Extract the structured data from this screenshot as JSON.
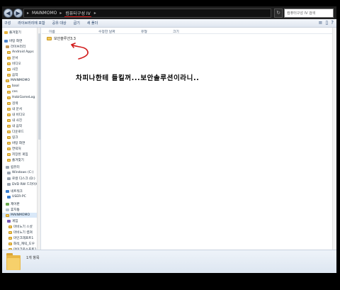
{
  "address_bar": {
    "breadcrumbs": [
      "MAINMOMO",
      "컴퓨터구성 IV"
    ],
    "search_placeholder": "컴퓨터구성 IV 검색"
  },
  "command_bar": {
    "items": [
      "구성",
      "라이브러리에 포함",
      "공유 대상",
      "굽기",
      "새 폴더"
    ],
    "view_icons": [
      "≡",
      "▯",
      "?"
    ]
  },
  "nav_pane": {
    "items": [
      {
        "label": "즐겨찾기",
        "icon": "star-icon"
      },
      {
        "label": "바탕 화면",
        "icon": "desktop-icon"
      },
      {
        "label": "라이브러리",
        "icon": "library-icon"
      },
      {
        "label": "Android Apps",
        "icon": "folder-icon"
      },
      {
        "label": "문서",
        "icon": "folder-icon"
      },
      {
        "label": "비디오",
        "icon": "folder-icon"
      },
      {
        "label": "사진",
        "icon": "folder-icon"
      },
      {
        "label": "음악",
        "icon": "folder-icon"
      },
      {
        "label": "MAINMOMO",
        "icon": "folder-icon"
      },
      {
        "label": "baal",
        "icon": "folder-icon"
      },
      {
        "label": "ces",
        "icon": "folder-icon"
      },
      {
        "label": "HobiGameLog",
        "icon": "folder-icon"
      },
      {
        "label": "검색",
        "icon": "folder-icon"
      },
      {
        "label": "내 문서",
        "icon": "folder-icon"
      },
      {
        "label": "내 비디오",
        "icon": "folder-icon"
      },
      {
        "label": "내 사진",
        "icon": "folder-icon"
      },
      {
        "label": "내 음악",
        "icon": "folder-icon"
      },
      {
        "label": "다운로드",
        "icon": "folder-icon"
      },
      {
        "label": "링크",
        "icon": "folder-icon"
      },
      {
        "label": "바탕 화면",
        "icon": "folder-icon"
      },
      {
        "label": "연락처",
        "icon": "folder-icon"
      },
      {
        "label": "저장된 게임",
        "icon": "folder-icon"
      },
      {
        "label": "즐겨찾기",
        "icon": "folder-icon"
      },
      {
        "label": "컴퓨터",
        "icon": "computer-icon"
      },
      {
        "label": "Windows (C:)",
        "icon": "drive-icon"
      },
      {
        "label": "로컬 디스크 (D:)",
        "icon": "drive-icon"
      },
      {
        "label": "DVD RW 드라이브",
        "icon": "drive-icon"
      },
      {
        "label": "네트워크",
        "icon": "network-icon"
      },
      {
        "label": "USER-PC",
        "icon": "network-icon"
      },
      {
        "label": "제어판",
        "icon": "control-panel-icon"
      },
      {
        "label": "휴지통",
        "icon": "trash-icon"
      },
      {
        "label": "MAINMOMO",
        "icon": "folder-icon"
      },
      {
        "label": "게임",
        "icon": "game-icon"
      },
      {
        "label": "마비노기 스샷",
        "icon": "folder-icon"
      },
      {
        "label": "마비노기 캡쳐",
        "icon": "folder-icon"
      },
      {
        "label": "마인크래프트1",
        "icon": "folder-icon"
      },
      {
        "label": "화석_캐릭_도우",
        "icon": "folder-icon"
      },
      {
        "label": "마이크로소프트1",
        "icon": "folder-icon"
      }
    ]
  },
  "main": {
    "column_headers": [
      "이름",
      "수정한 날짜",
      "유형",
      "크기"
    ],
    "files": [
      {
        "name": "보안솔루션3.3",
        "icon": "folder-icon"
      }
    ],
    "caption": "차피나한테 들킬꺼...보안솔루션이라니.."
  },
  "details": {
    "item_count": "1개 항목"
  },
  "colors": {
    "selection": "#d9e8f8",
    "arrow": "#d21b1b",
    "folder": "#f1c75a"
  }
}
